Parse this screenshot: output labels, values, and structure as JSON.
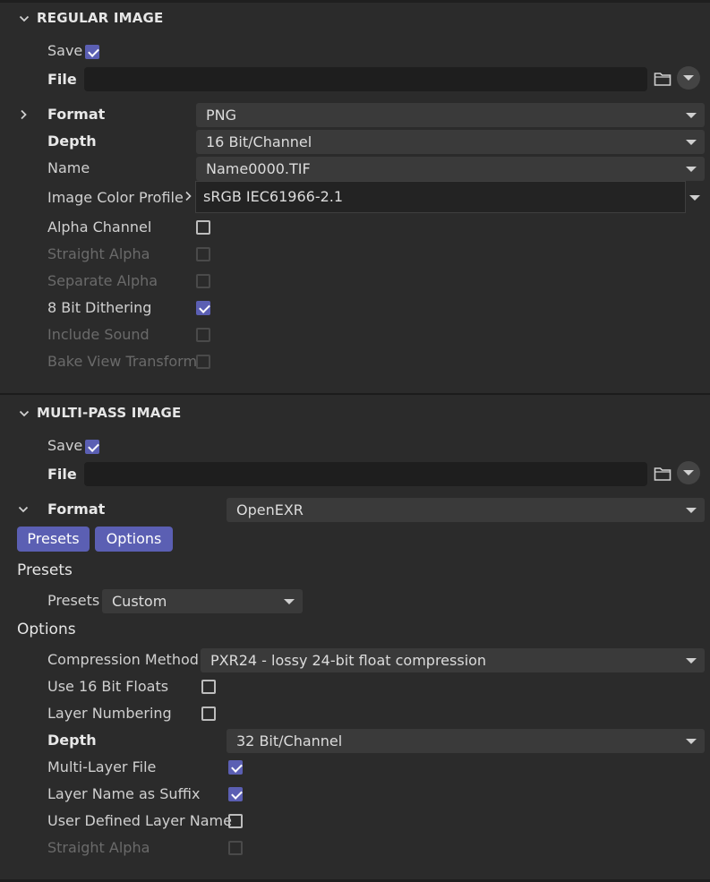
{
  "regular_image": {
    "title": "REGULAR IMAGE",
    "save_label": "Save",
    "save_checked": true,
    "file_label": "File",
    "format_label": "Format",
    "format_value": "PNG",
    "depth_label": "Depth",
    "depth_value": "16 Bit/Channel",
    "name_label": "Name",
    "name_value": "Name0000.TIF",
    "profile_label": "Image Color Profile",
    "profile_value": "sRGB IEC61966-2.1",
    "options": [
      {
        "label": "Alpha Channel",
        "checked": false,
        "enabled": true
      },
      {
        "label": "Straight Alpha",
        "checked": false,
        "enabled": false
      },
      {
        "label": "Separate Alpha",
        "checked": false,
        "enabled": false
      },
      {
        "label": "8 Bit Dithering",
        "checked": true,
        "enabled": true
      },
      {
        "label": "Include Sound",
        "checked": false,
        "enabled": false
      },
      {
        "label": "Bake View Transform",
        "checked": false,
        "enabled": false
      }
    ]
  },
  "multipass_image": {
    "title": "MULTI-PASS IMAGE",
    "save_label": "Save",
    "save_checked": true,
    "file_label": "File",
    "format_label": "Format",
    "format_value": "OpenEXR",
    "presets_button": "Presets",
    "options_button": "Options",
    "presets_heading": "Presets",
    "presets_label": "Presets",
    "presets_value": "Custom",
    "options_heading": "Options",
    "compression_label": "Compression Method",
    "compression_value": "PXR24 - lossy 24-bit float compression",
    "use16_label": "Use 16 Bit Floats",
    "use16_checked": false,
    "layer_numbering_label": "Layer Numbering",
    "layer_numbering_checked": false,
    "depth_label": "Depth",
    "depth_value": "32 Bit/Channel",
    "multilayer_label": "Multi-Layer File",
    "multilayer_checked": true,
    "suffix_label": "Layer Name as Suffix",
    "suffix_checked": true,
    "userdefined_label": "User Defined Layer Name",
    "userdefined_checked": false,
    "straight_alpha_label": "Straight Alpha",
    "straight_alpha_checked": false
  },
  "icons": [
    "chevron-down-icon",
    "chevron-right-icon",
    "folder-icon",
    "dropdown-arrow-icon",
    "checkmark-icon"
  ],
  "colors": {
    "accent": "#5b5fb3",
    "background": "#2b2b2b",
    "field": "#3a3a3a",
    "file_field": "#1e1e1e"
  }
}
